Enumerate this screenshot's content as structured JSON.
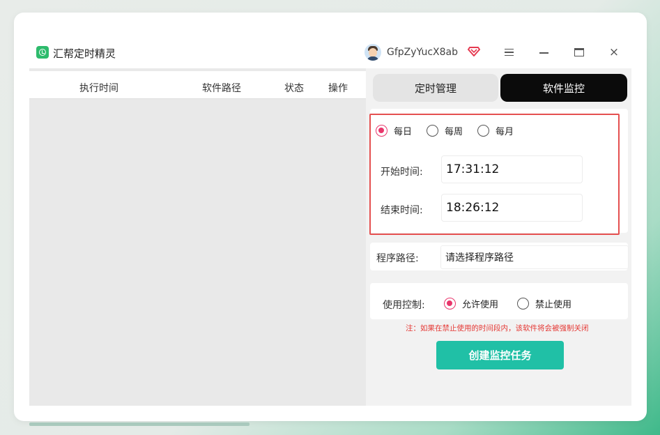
{
  "app": {
    "title": "汇帮定时精灵",
    "username": "GfpZyYucX8ab"
  },
  "window_controls": {
    "menu_icon": "hamburger-menu-icon",
    "minimize_icon": "minimize-icon",
    "maximize_icon": "maximize-icon",
    "close_icon": "close-icon",
    "close_glyph": "×"
  },
  "table": {
    "columns": [
      "执行时间",
      "软件路径",
      "状态",
      "操作"
    ],
    "rows": []
  },
  "tabs": [
    {
      "label": "定时管理",
      "active": false
    },
    {
      "label": "软件监控",
      "active": true
    }
  ],
  "frequency": {
    "options": [
      {
        "label": "每日",
        "selected": true
      },
      {
        "label": "每周",
        "selected": false
      },
      {
        "label": "每月",
        "selected": false
      }
    ]
  },
  "start_time": {
    "label": "开始时间:",
    "value": "17:31:12"
  },
  "end_time": {
    "label": "结束时间:",
    "value": "18:26:12"
  },
  "program_path": {
    "label": "程序路径:",
    "placeholder": "请选择程序路径"
  },
  "usage_control": {
    "label": "使用控制:",
    "options": [
      {
        "label": "允许使用",
        "selected": true
      },
      {
        "label": "禁止使用",
        "selected": false
      }
    ]
  },
  "note": "注：如果在禁止使用的时间段内，该软件将会被强制关闭",
  "create_button": "创建监控任务",
  "colors": {
    "accent_pink": "#e8366b",
    "button_teal": "#20c0a6",
    "highlight_red": "#e55050",
    "active_tab": "#0b0b0b",
    "logo_green": "#2dbb6c"
  }
}
